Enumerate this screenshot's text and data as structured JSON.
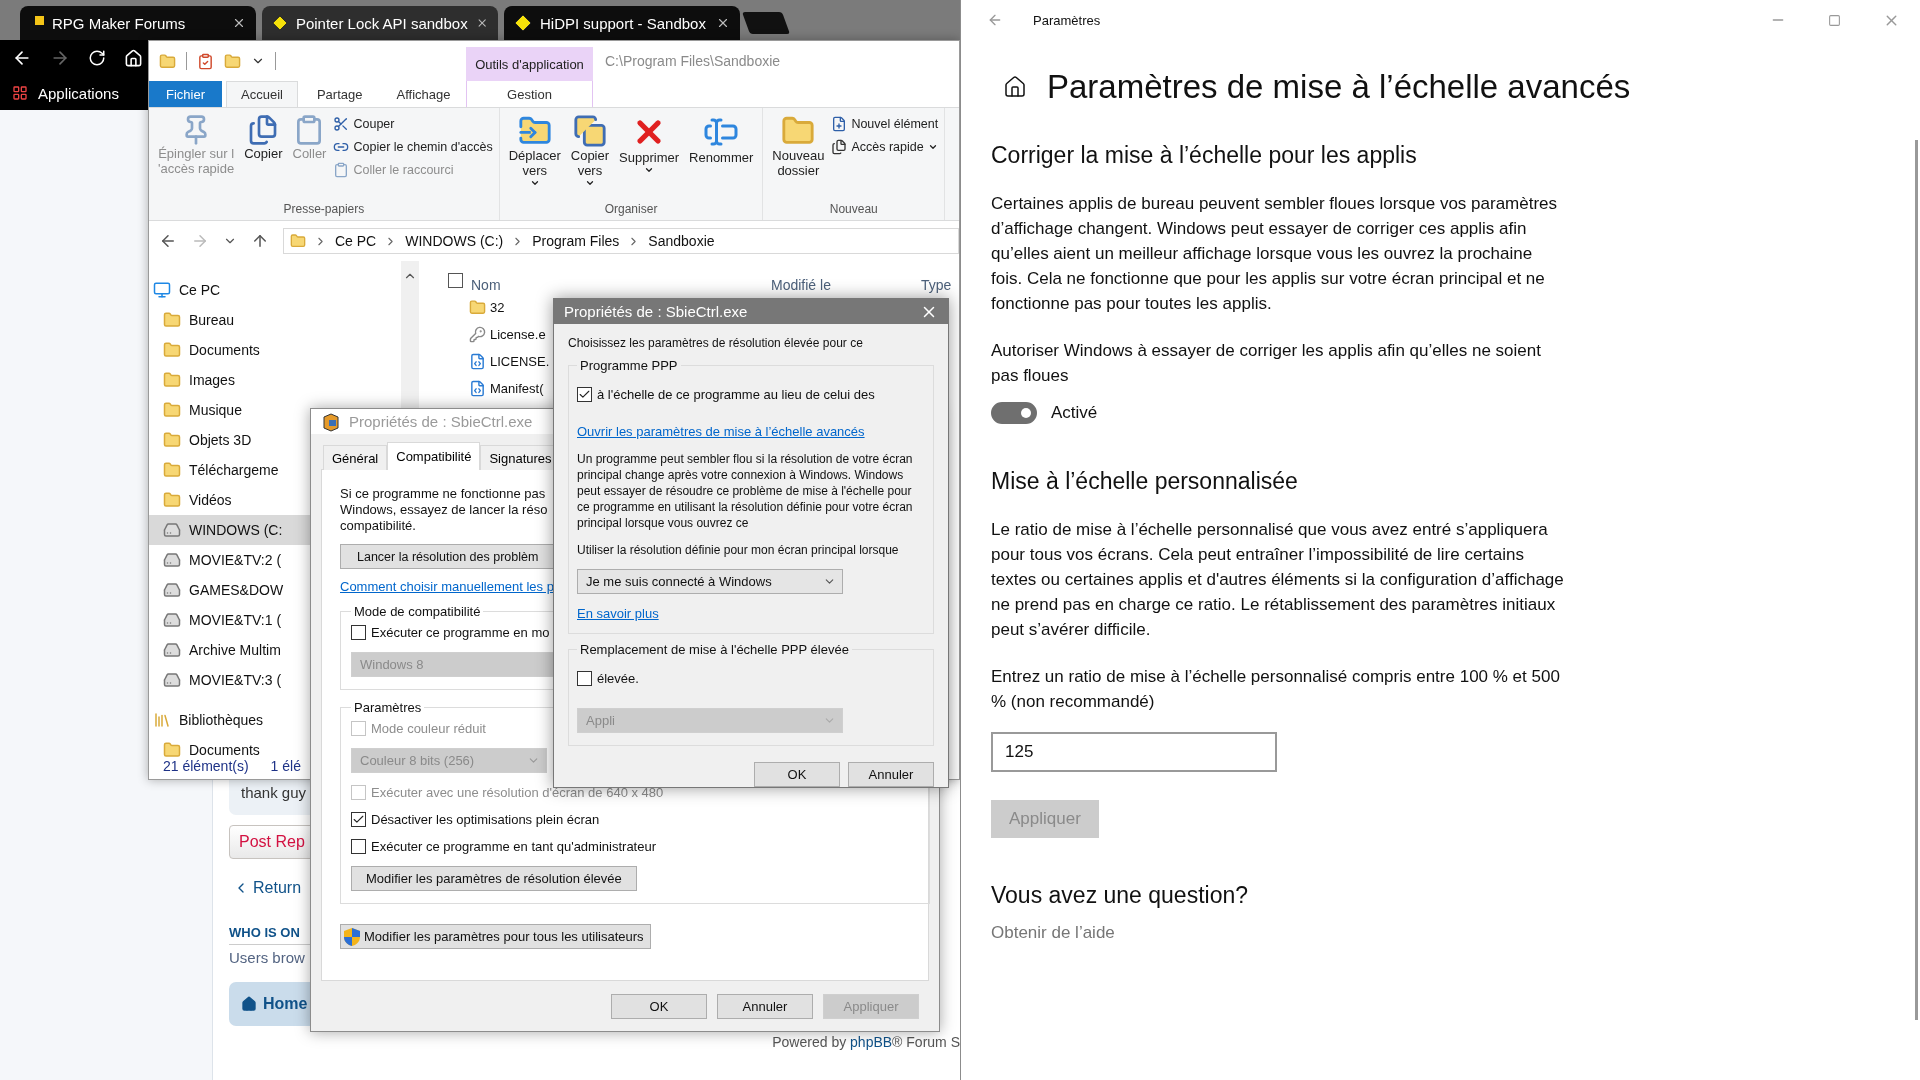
{
  "browser": {
    "tabs": [
      {
        "title": "RPG Maker Forums",
        "selected": false
      },
      {
        "title": "Pointer Lock API sandbox",
        "selected": true
      },
      {
        "title": "HiDPI support - Sandbox",
        "selected": false
      }
    ],
    "bookmark": "Applications",
    "forum": {
      "post_excerpt": "thank guy",
      "reply_button": "Post Rep",
      "return_link": "Return",
      "who_heading": "WHO IS ON",
      "users_text": "Users brow",
      "home_link": "Home",
      "powered_prefix": "Powered by",
      "powered_link": "phpBB",
      "powered_suffix": "® Forum S"
    }
  },
  "explorer": {
    "context_tab": "Outils d'application",
    "path": "C:\\Program Files\\Sandboxie",
    "ribbon_tabs": [
      {
        "label": "Fichier",
        "kind": "menu",
        "selected": false
      },
      {
        "label": "Accueil",
        "kind": "tab",
        "selected": true
      },
      {
        "label": "Partage",
        "kind": "tab",
        "selected": false
      },
      {
        "label": "Affichage",
        "kind": "tab",
        "selected": false
      }
    ],
    "context_subtab": "Gestion",
    "ribbon_groups": [
      {
        "label": "Presse-papiers",
        "large": [
          {
            "lines": [
              "Épingler sur l",
              "'accès rapide"
            ],
            "disabled": true,
            "menu": false
          },
          {
            "lines": [
              "Copier"
            ],
            "disabled": false,
            "menu": false
          },
          {
            "lines": [
              "Coller"
            ],
            "disabled": true,
            "menu": false
          }
        ],
        "small": [
          {
            "label": "Couper",
            "disabled": false,
            "menu": false
          },
          {
            "label": "Copier le chemin d'accès",
            "disabled": false,
            "menu": false
          },
          {
            "label": "Coller le raccourci",
            "disabled": true,
            "menu": false
          }
        ]
      },
      {
        "label": "Organiser",
        "large": [
          {
            "lines": [
              "Déplacer",
              "vers"
            ],
            "disabled": false,
            "menu": true
          },
          {
            "lines": [
              "Copier",
              "vers"
            ],
            "disabled": false,
            "menu": true
          },
          {
            "lines": [
              "Supprimer"
            ],
            "disabled": false,
            "menu": true
          },
          {
            "lines": [
              "Renommer"
            ],
            "disabled": false,
            "menu": false
          }
        ]
      },
      {
        "label": "Nouveau",
        "large": [
          {
            "lines": [
              "Nouveau",
              "dossier"
            ],
            "disabled": false,
            "menu": false
          }
        ],
        "small": [
          {
            "label": "Nouvel élément",
            "disabled": false,
            "menu": false
          },
          {
            "label": "Accès rapide",
            "disabled": false,
            "menu": true
          }
        ]
      }
    ],
    "breadcrumbs": [
      "Ce PC",
      "WINDOWS (C:)",
      "Program Files",
      "Sandboxie"
    ],
    "tree": [
      {
        "label": "Ce PC",
        "kind": "pc",
        "selected": false,
        "children": [
          {
            "label": "Bureau",
            "kind": "folder",
            "selected": false
          },
          {
            "label": "Documents",
            "kind": "folder",
            "selected": false
          },
          {
            "label": "Images",
            "kind": "folder",
            "selected": false
          },
          {
            "label": "Musique",
            "kind": "folder",
            "selected": false
          },
          {
            "label": "Objets 3D",
            "kind": "folder",
            "selected": false
          },
          {
            "label": "Téléchargeme",
            "kind": "folder",
            "selected": false
          },
          {
            "label": "Vidéos",
            "kind": "folder",
            "selected": false
          },
          {
            "label": "WINDOWS (C:",
            "kind": "drive",
            "selected": true
          },
          {
            "label": "MOVIE&TV:2 (",
            "kind": "drive",
            "selected": false
          },
          {
            "label": "GAMES&DOW",
            "kind": "drive",
            "selected": false
          },
          {
            "label": "MOVIE&TV:1 (",
            "kind": "drive",
            "selected": false
          },
          {
            "label": "Archive Multim",
            "kind": "drive",
            "selected": false
          },
          {
            "label": "MOVIE&TV:3 (",
            "kind": "drive",
            "selected": false
          }
        ]
      },
      {
        "label": "Bibliothèques",
        "kind": "library",
        "selected": false,
        "children": [
          {
            "label": "Documents",
            "kind": "folder",
            "selected": false
          }
        ]
      }
    ],
    "select_all_checked": false,
    "columns": [
      "Nom",
      "Modifié le",
      "Type"
    ],
    "files": [
      {
        "name": "32",
        "kind": "folder"
      },
      {
        "name": "License.e",
        "kind": "app"
      },
      {
        "name": "LICENSE.",
        "kind": "doc"
      },
      {
        "name": "Manifest(",
        "kind": "doc"
      }
    ],
    "status": [
      "21 élément(s)",
      "1 élé"
    ]
  },
  "compat_dialog": {
    "title": "Propriétés de : SbieCtrl.exe",
    "tabs": [
      {
        "label": "Général",
        "selected": false
      },
      {
        "label": "Compatibilité",
        "selected": true
      },
      {
        "label": "Signatures",
        "selected": false
      }
    ],
    "intro": [
      "Si ce programme ne fonctionne pas",
      "Windows, essayez de lancer la réso",
      "compatibilité."
    ],
    "troubleshoot_button": "Lancer la résolution des problèm",
    "manual_link": "Comment choisir manuellement les p",
    "mode_group": {
      "legend": "Mode de compatibilité",
      "option": {
        "label": "Exécuter ce programme en mo",
        "checked": false,
        "disabled": false
      },
      "select": {
        "value": "Windows 8",
        "disabled": true
      }
    },
    "settings_group": {
      "legend": "Paramètres",
      "items": [
        {
          "kind": "checkbox",
          "label": "Mode couleur réduit",
          "checked": false,
          "disabled": true
        },
        {
          "kind": "select",
          "value": "Couleur 8 bits (256)",
          "disabled": true
        },
        {
          "kind": "checkbox",
          "label": "Exécuter avec une résolution d'écran de 640 x 480",
          "checked": false,
          "disabled": true
        },
        {
          "kind": "checkbox",
          "label": "Désactiver les optimisations plein écran",
          "checked": true,
          "disabled": false
        },
        {
          "kind": "checkbox",
          "label": "Exécuter ce programme en tant qu'administrateur",
          "checked": false,
          "disabled": false
        },
        {
          "kind": "button",
          "label": "Modifier les paramètres de résolution élevée"
        }
      ]
    },
    "all_users_button": "Modifier les paramètres pour tous les utilisateurs",
    "buttons": [
      {
        "label": "OK",
        "disabled": false
      },
      {
        "label": "Annuler",
        "disabled": false
      },
      {
        "label": "Appliquer",
        "disabled": true
      }
    ]
  },
  "dpi_dialog": {
    "title": "Propriétés de : SbieCtrl.exe",
    "intro": "Choisissez les paramètres de résolution élevée pour ce",
    "program_group": {
      "legend": "Programme PPP",
      "override": {
        "label": "à l'échelle de ce programme au lieu de celui des",
        "checked": true
      },
      "advanced_link": "Ouvrir les paramètres de mise à l’échelle avancés",
      "description": "Un programme peut sembler flou si la résolution de votre écran principal change après votre connexion à Windows. Windows peut essayer de résoudre ce problème de mise à l'échelle pour ce programme en utilisant la résolution définie pour votre écran principal lorsque vous ouvrez ce",
      "use_label": "Utiliser la résolution définie pour mon écran principal lorsque",
      "select": {
        "value": "Je me suis connecté à Windows",
        "disabled": false
      },
      "more_link": "En savoir plus"
    },
    "override_group": {
      "legend": "Remplacement de mise à l'échelle PPP élevée",
      "override": {
        "label": "élevée.",
        "checked": false
      },
      "select": {
        "value": "Appli",
        "disabled": true
      }
    },
    "buttons": [
      {
        "label": "OK",
        "disabled": false
      },
      {
        "label": "Annuler",
        "disabled": false
      }
    ]
  },
  "settings": {
    "window_title": "Paramètres",
    "heading": "Paramètres de mise à l’échelle avancés",
    "fix_section": {
      "heading": "Corriger la mise à l’échelle pour les applis",
      "description": "Certaines applis de bureau peuvent sembler floues lorsque vos paramètres d’affichage changent. Windows peut essayer de corriger ces applis afin qu’elles aient un meilleur affichage lorsque vous les ouvrez la prochaine fois. Cela ne fonctionne que pour les applis sur votre écran principal et ne fonctionne pas pour toutes les applis.",
      "toggle_label": "Autoriser Windows à essayer de corriger les applis afin qu’elles ne soient pas floues",
      "toggle": {
        "on": true,
        "state_text": "Activé"
      }
    },
    "custom_section": {
      "heading": "Mise à l’échelle personnalisée",
      "description": "Le ratio de mise à l’échelle personnalisé que vous avez entré s’appliquera pour tous vos écrans. Cela peut entraîner l’impossibilité de lire certains textes ou certaines applis et d'autres éléments si la configuration d’affichage ne prend pas en charge ce ratio. Le rétablissement des paramètres initiaux peut s’avérer difficile.",
      "field_label": "Entrez un ratio de mise à l’échelle personnalisé compris entre 100 % et 500 % (non recommandé)",
      "field_value": "125",
      "apply_button": {
        "label": "Appliquer",
        "disabled": true
      }
    },
    "help_section": {
      "heading": "Vous avez une question?",
      "link": "Obtenir de l’aide"
    }
  }
}
